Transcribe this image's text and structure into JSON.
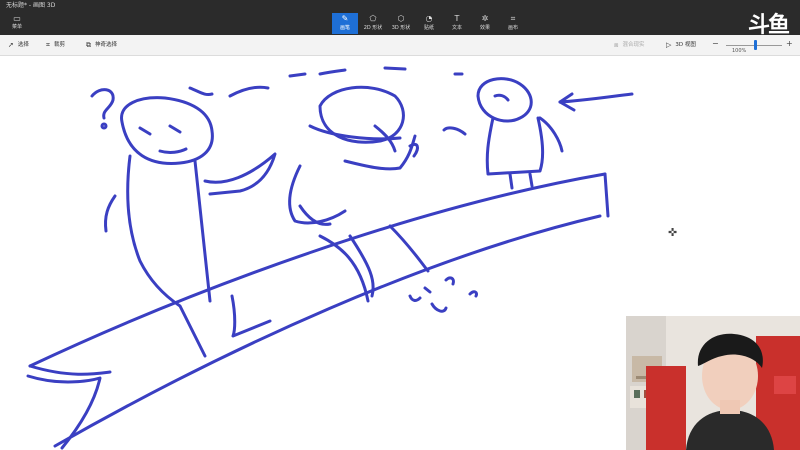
{
  "window": {
    "title": "无标题* - 画图 3D"
  },
  "toolbar": {
    "menu_label": "菜单",
    "tools": [
      {
        "label": "画笔",
        "icon": "brush-icon",
        "active": true
      },
      {
        "label": "2D 形状",
        "icon": "shapes-2d-icon",
        "active": false
      },
      {
        "label": "3D 形状",
        "icon": "shapes-3d-icon",
        "active": false
      },
      {
        "label": "贴纸",
        "icon": "stickers-icon",
        "active": false
      },
      {
        "label": "文本",
        "icon": "text-icon",
        "active": false
      },
      {
        "label": "效果",
        "icon": "effects-icon",
        "active": false
      },
      {
        "label": "画布",
        "icon": "canvas-icon",
        "active": false
      }
    ],
    "logo_text": "斗鱼"
  },
  "subbar": {
    "select_label": "选择",
    "crop_label": "裁剪",
    "magic_select_label": "神奇选择",
    "mixed_reality_label": "混合现实",
    "view_3d_label": "3D 视图",
    "zoom_readout": "100%"
  },
  "colors": {
    "ink": "#3a3fc2",
    "accent": "#1e6fd6",
    "titlebar": "#2b2b2b"
  }
}
